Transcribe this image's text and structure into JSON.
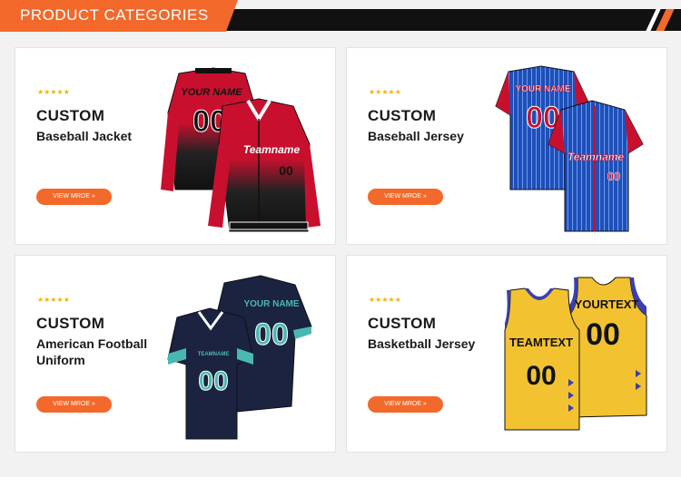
{
  "header": {
    "title": "PRODUCT CATEGORIES"
  },
  "colors": {
    "accent": "#f2692b",
    "dark": "#111111",
    "star": "#f5b301"
  },
  "cards": [
    {
      "stars": "★★★★★",
      "title": "CUSTOM",
      "subtitle": "Baseball Jacket",
      "button": "VIEW MROE »",
      "front_name": "Teamname",
      "back_name": "YOUR NAME",
      "front_number": "00",
      "back_number": "00"
    },
    {
      "stars": "★★★★★",
      "title": "CUSTOM",
      "subtitle": "Baseball Jersey",
      "button": "VIEW MROE »",
      "front_name": "Teamname",
      "back_name": "YOUR NAME",
      "front_number": "00",
      "back_number": "00"
    },
    {
      "stars": "★★★★★",
      "title": "CUSTOM",
      "subtitle": "American Football Uniform",
      "button": "VIEW MROE »",
      "front_name": "TEAMNAME",
      "back_name": "YOUR NAME",
      "front_number": "00",
      "back_number": "00"
    },
    {
      "stars": "★★★★★",
      "title": "CUSTOM",
      "subtitle": "Basketball Jersey",
      "button": "VIEW MROE »",
      "front_name": "TEAMTEXT",
      "back_name": "YOURTEXT",
      "front_number": "00",
      "back_number": "00"
    }
  ]
}
